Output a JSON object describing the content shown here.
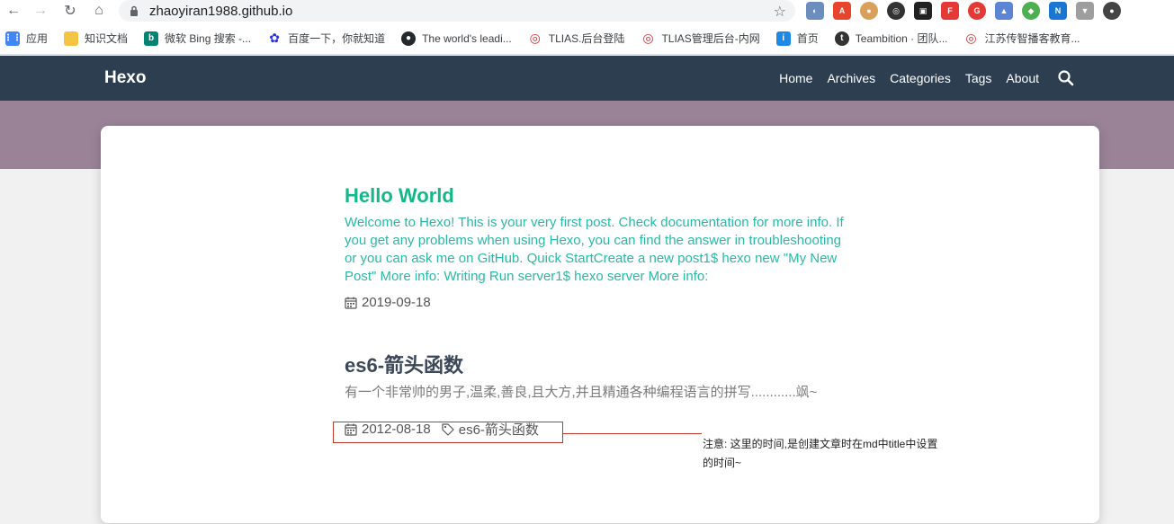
{
  "browser": {
    "url": "zhaoyiran1988.github.io"
  },
  "bookmarks": [
    {
      "label": "应用",
      "icon": "apps-grid-icon",
      "color": "#4285f4"
    },
    {
      "label": "知识文档",
      "icon": "folder-icon",
      "color": "#f4c542"
    },
    {
      "label": "微软 Bing 搜索 -...",
      "icon": "bing-icon",
      "color": "#008373"
    },
    {
      "label": "百度一下，你就知道",
      "icon": "baidu-paw-icon",
      "color": "#2932e1"
    },
    {
      "label": "The world's leadi...",
      "icon": "github-icon",
      "color": "#24292e"
    },
    {
      "label": "TLIAS.后台登陆",
      "icon": "tlias-icon",
      "color": "#d32f2f"
    },
    {
      "label": "TLIAS管理后台-内网",
      "icon": "tlias-icon",
      "color": "#d32f2f"
    },
    {
      "label": "首页",
      "icon": "info-icon",
      "color": "#1e88e5"
    },
    {
      "label": "Teambition · 团队...",
      "icon": "teambition-icon",
      "color": "#333333"
    },
    {
      "label": "江苏传智播客教育...",
      "icon": "itcast-icon",
      "color": "#d32f2f"
    }
  ],
  "site": {
    "brand": "Hexo",
    "menu": [
      "Home",
      "Archives",
      "Categories",
      "Tags",
      "About"
    ]
  },
  "posts": [
    {
      "title": "Hello World",
      "excerpt": "Welcome to Hexo! This is your very first post. Check documentation for more info. If you get any problems when using Hexo, you can find the answer in troubleshooting or you can ask me on GitHub. Quick StartCreate a new post1$ hexo new \"My New Post\" More info: Writing Run server1$ hexo server More info:",
      "date": "2019-09-18"
    },
    {
      "title": "es6-箭头函数",
      "excerpt": "有一个非常帅的男子,温柔,善良,且大方,并且精通各种编程语言的拼写............飒~",
      "date": "2012-08-18",
      "tag": "es6-箭头函数"
    }
  ],
  "annotation": {
    "text": "注意: 这里的时间,是创建文章时在md中title中设置的时间~"
  }
}
